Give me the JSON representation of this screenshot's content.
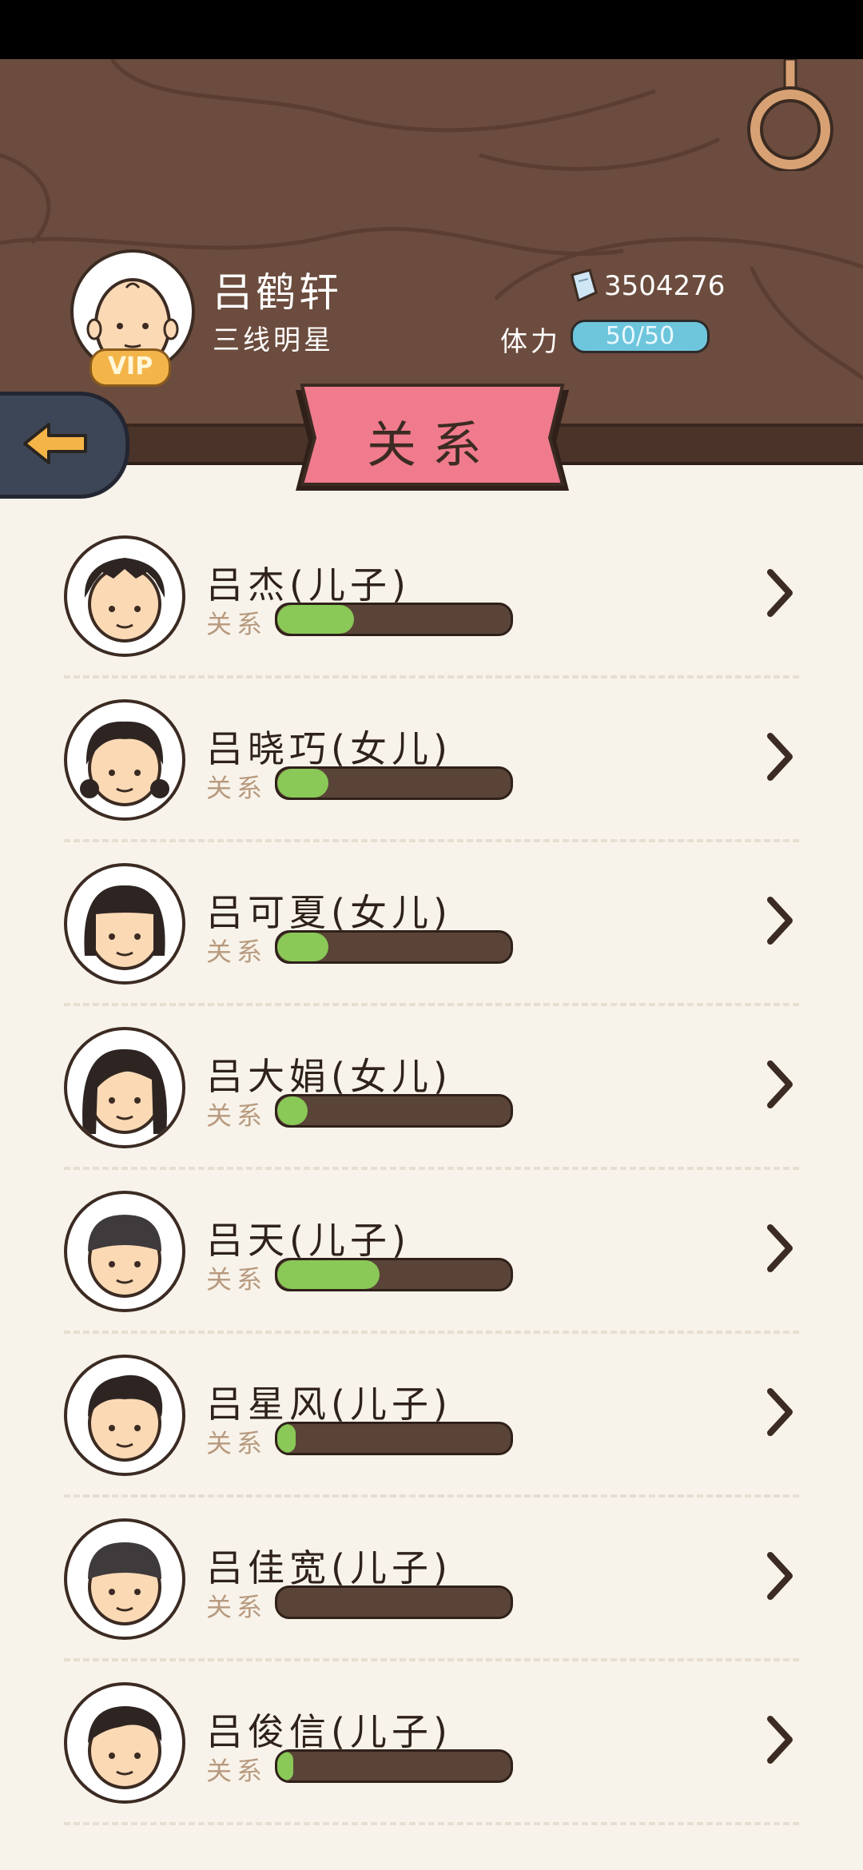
{
  "player": {
    "name": "吕鹤轩",
    "title": "三线明星",
    "vip_badge": "VIP",
    "currency_value": "3504276",
    "stamina_label": "体力",
    "stamina_value": "50/50"
  },
  "banner": {
    "title": "关系"
  },
  "relations": {
    "label": "关系",
    "items": [
      {
        "name": "吕杰(儿子)",
        "level": 0.33,
        "hair": "spiky"
      },
      {
        "name": "吕晓巧(女儿)",
        "level": 0.22,
        "hair": "pigtails"
      },
      {
        "name": "吕可夏(女儿)",
        "level": 0.22,
        "hair": "bob"
      },
      {
        "name": "吕大娟(女儿)",
        "level": 0.13,
        "hair": "long"
      },
      {
        "name": "吕天(儿子)",
        "level": 0.44,
        "hair": "cap"
      },
      {
        "name": "吕星风(儿子)",
        "level": 0.08,
        "hair": "quiff"
      },
      {
        "name": "吕佳宽(儿子)",
        "level": 0.0,
        "hair": "cap"
      },
      {
        "name": "吕俊信(儿子)",
        "level": 0.07,
        "hair": "side"
      }
    ]
  },
  "colors": {
    "header_wood": "#6c4c3e",
    "banner_pink": "#f07b8d",
    "bar_fill_green": "#8ac858",
    "stamina_blue": "#6ec6dd",
    "back_button": "#3d4656"
  },
  "icons": [
    "back-arrow-icon",
    "ticket-icon",
    "chevron-right-icon",
    "ring-icon"
  ]
}
